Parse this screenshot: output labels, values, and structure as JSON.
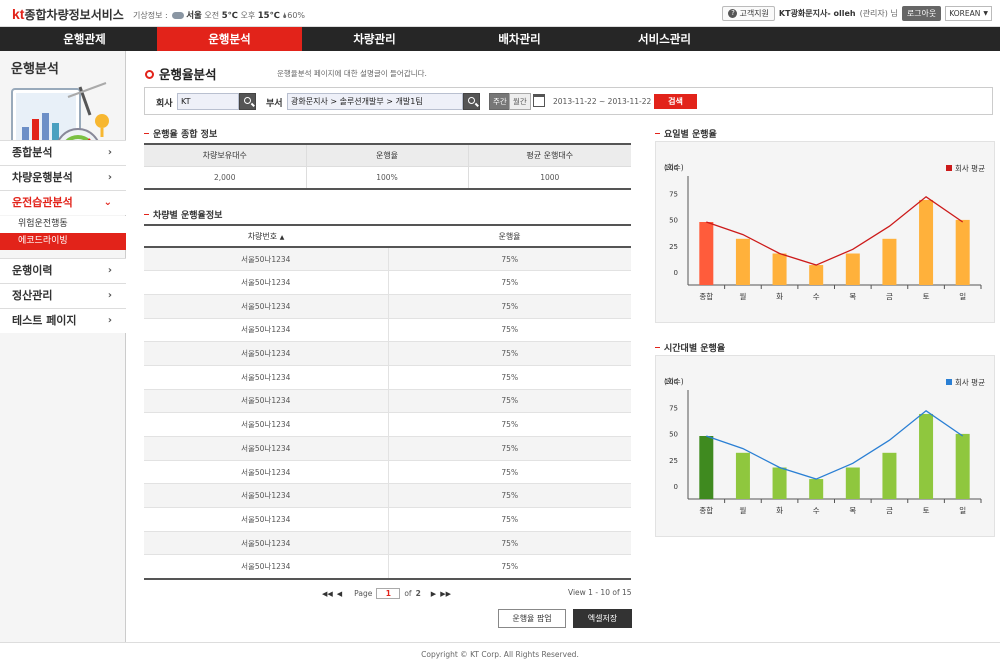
{
  "header": {
    "brand_kt": "kt",
    "brand_name": "종합차량정보서비스",
    "weather": {
      "label": "기상정보 :",
      "city": "서울",
      "am_label": "오전",
      "am_temp": "5℃",
      "pm_label": "오후",
      "pm_temp": "15℃",
      "humidity": "60%"
    },
    "support_label": "고객지원",
    "user_text": "KT광화문지사- olleh",
    "user_role": "(관리자) 님",
    "logout_label": "로그아웃",
    "language": "KOREAN"
  },
  "nav": {
    "items": [
      {
        "label": "운행관제"
      },
      {
        "label": "운행분석"
      },
      {
        "label": "차량관리"
      },
      {
        "label": "배차관리"
      },
      {
        "label": "서비스관리"
      }
    ],
    "active_index": 1
  },
  "sidebar": {
    "title": "운행분석",
    "menus": [
      {
        "label": "종합분석"
      },
      {
        "label": "차량운행분석"
      },
      {
        "label": "운전습관분석"
      },
      {
        "label": "운행이력"
      },
      {
        "label": "정산관리"
      },
      {
        "label": "테스트 페이지"
      }
    ],
    "submenus": [
      {
        "label": "위험운전행동"
      },
      {
        "label": "에코드라이빙"
      }
    ]
  },
  "page": {
    "title": "운행율분석",
    "description": "운행율분석 페이지에 대한 설명글이 들어갑니다."
  },
  "search": {
    "company_label": "회사",
    "company_value": "KT",
    "dept_label": "부서",
    "dept_value": "광화문지사 > 솔루션개발부 > 개발1팀",
    "weekly_label": "주간",
    "monthly_label": "월간",
    "date_from": "2013-11-22",
    "date_sep": "~",
    "date_to": "2013-11-22",
    "search_label": "검색"
  },
  "summary": {
    "heading": "운행율 종합 정보",
    "headers": [
      "차량보유대수",
      "운행율",
      "평균 운행대수"
    ],
    "values": [
      "2,000",
      "100%",
      "1000"
    ]
  },
  "vehicles": {
    "heading": "차량별 운행율정보",
    "headers": [
      "차량번호",
      "운행율"
    ],
    "sort_indicator": "▲",
    "rows": [
      [
        "서울50나1234",
        "75%"
      ],
      [
        "서울50나1234",
        "75%"
      ],
      [
        "서울50나1234",
        "75%"
      ],
      [
        "서울50나1234",
        "75%"
      ],
      [
        "서울50나1234",
        "75%"
      ],
      [
        "서울50나1234",
        "75%"
      ],
      [
        "서울50나1234",
        "75%"
      ],
      [
        "서울50나1234",
        "75%"
      ],
      [
        "서울50나1234",
        "75%"
      ],
      [
        "서울50나1234",
        "75%"
      ],
      [
        "서울50나1234",
        "75%"
      ],
      [
        "서울50나1234",
        "75%"
      ],
      [
        "서울50나1234",
        "75%"
      ],
      [
        "서울50나1234",
        "75%"
      ]
    ]
  },
  "pager": {
    "first": "◀◀",
    "prev": "◀",
    "page_label": "Page",
    "current": "1",
    "of_label": "of",
    "total": "2",
    "next": "▶",
    "last": "▶▶",
    "view_info": "View 1 - 10 of 15"
  },
  "actions": {
    "popup_label": "운행율 팝업",
    "excel_label": "엑셀저장"
  },
  "charts": {
    "weekday_heading": "요일별 운행율",
    "hourly_heading": "시간대별 운행율"
  },
  "chart_data": [
    {
      "type": "bar",
      "ylabel": "(회수)",
      "ylim": [
        0,
        100
      ],
      "yticks": [
        "100",
        "75",
        "50",
        "25",
        "0"
      ],
      "categories": [
        "종합",
        "월",
        "화",
        "수",
        "목",
        "금",
        "토",
        "일"
      ],
      "series": [
        {
          "values": [
            60,
            44,
            30,
            19,
            30,
            44,
            81,
            62
          ]
        },
        {
          "name": "회사 평균",
          "values": [
            60,
            48,
            30,
            19,
            34,
            56,
            84,
            60
          ]
        }
      ],
      "colors": {
        "bar": "#ffb13b",
        "bar_highlight": "#ff5c3b",
        "line": "#cc1a1a"
      },
      "legend": "top-right",
      "grid": false
    },
    {
      "type": "bar",
      "ylabel": "(회수)",
      "ylim": [
        0,
        100
      ],
      "yticks": [
        "100",
        "75",
        "50",
        "25",
        "0"
      ],
      "categories": [
        "종합",
        "월",
        "화",
        "수",
        "목",
        "금",
        "토",
        "일"
      ],
      "series": [
        {
          "values": [
            60,
            44,
            30,
            19,
            30,
            44,
            81,
            62
          ]
        },
        {
          "name": "회사 평균",
          "values": [
            60,
            48,
            30,
            19,
            34,
            56,
            84,
            60
          ]
        }
      ],
      "colors": {
        "bar": "#8fc73e",
        "bar_highlight": "#3f8a1f",
        "line": "#2a7fd4"
      },
      "legend": "top-right",
      "grid": false
    }
  ],
  "footer": {
    "copyright": "Copyright © KT Corp. All Rights Reserved."
  }
}
